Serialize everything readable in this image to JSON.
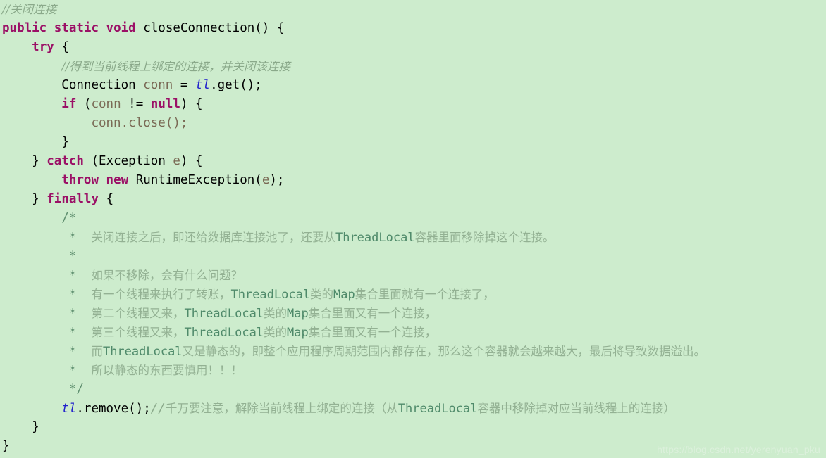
{
  "editor": {
    "background_color": "#cdeccd",
    "language": "java",
    "keyword_color": "#9b1066",
    "comment_color": "#8aa98a",
    "block_comment_color": "#5f8f6f",
    "field_color": "#2222cc",
    "identifier_color": "#7a6a55",
    "text_color": "#000000"
  },
  "watermark": {
    "text": "https://blog.csdn.net/yerenyuan_pku",
    "color": "#dcf0dc"
  },
  "code": {
    "line_01": {
      "comment": "//关闭连接"
    },
    "line_02": {
      "kw_public": "public",
      "kw_static": "static",
      "kw_void": "void",
      "method": "closeConnection()",
      "brace": "{"
    },
    "line_03": {
      "kw_try": "try",
      "brace": "{"
    },
    "line_04": {
      "comment": "//得到当前线程上绑定的连接，并关闭该连接"
    },
    "line_05": {
      "type": "Connection",
      "var": "conn",
      "assign": "=",
      "field": "tl",
      "call": ".get();"
    },
    "line_06": {
      "kw_if": "if",
      "open_paren": "(",
      "var": "conn",
      "op": "!=",
      "kw_null": "null",
      "close": ") {"
    },
    "line_07": {
      "text": "conn.close();"
    },
    "line_08": {
      "text": "}"
    },
    "line_09": {
      "close_brace": "}",
      "kw_catch": "catch",
      "open_paren": "(",
      "type": "Exception",
      "var": "e",
      "close": ") {"
    },
    "line_10": {
      "kw_throw": "throw",
      "kw_new": "new",
      "type": "RuntimeException",
      "open_paren": "(",
      "var": "e",
      "close": ");"
    },
    "line_11": {
      "close_brace": "}",
      "kw_finally": "finally",
      "brace": "{"
    },
    "line_12": {
      "text": "/*"
    },
    "line_13": {
      "star": "*",
      "cn_a": "关闭连接之后，即还给数据库连接池了，还要从",
      "code": "ThreadLocal",
      "cn_b": "容器里面移除掉这个连接。"
    },
    "line_14": {
      "star": "*"
    },
    "line_15": {
      "star": "*",
      "cn_a": "如果不移除，会有什么问题？"
    },
    "line_16": {
      "star": "*",
      "cn_a": "有一个线程来执行了转账，",
      "code_a": "ThreadLocal",
      "cn_b": "类的",
      "code_b": "Map",
      "cn_c": "集合里面就有一个连接了，"
    },
    "line_17": {
      "star": "*",
      "cn_a": "第二个线程又来，",
      "code_a": "ThreadLocal",
      "cn_b": "类的",
      "code_b": "Map",
      "cn_c": "集合里面又有一个连接，"
    },
    "line_18": {
      "star": "*",
      "cn_a": "第三个线程又来，",
      "code_a": "ThreadLocal",
      "cn_b": "类的",
      "code_b": "Map",
      "cn_c": "集合里面又有一个连接，"
    },
    "line_19": {
      "star": "*",
      "cn_a": "而",
      "code_a": "ThreadLocal",
      "cn_b": "又是静态的，即整个应用程序周期范围内都存在，那么这个容器就会越来越大，最后将导致数据溢出。"
    },
    "line_20": {
      "star": "*",
      "cn_a": "所以静态的东西要慎用！！！"
    },
    "line_21": {
      "text": "*/"
    },
    "line_22": {
      "field": "tl",
      "call": ".remove();",
      "slashes": "//",
      "cn_a": "千万要注意，解除当前线程上绑定的连接（从",
      "code": "ThreadLocal",
      "cn_b": "容器中移除掉对应当前线程上的连接）"
    },
    "line_23": {
      "text": "}"
    },
    "line_24": {
      "text": "}"
    }
  }
}
